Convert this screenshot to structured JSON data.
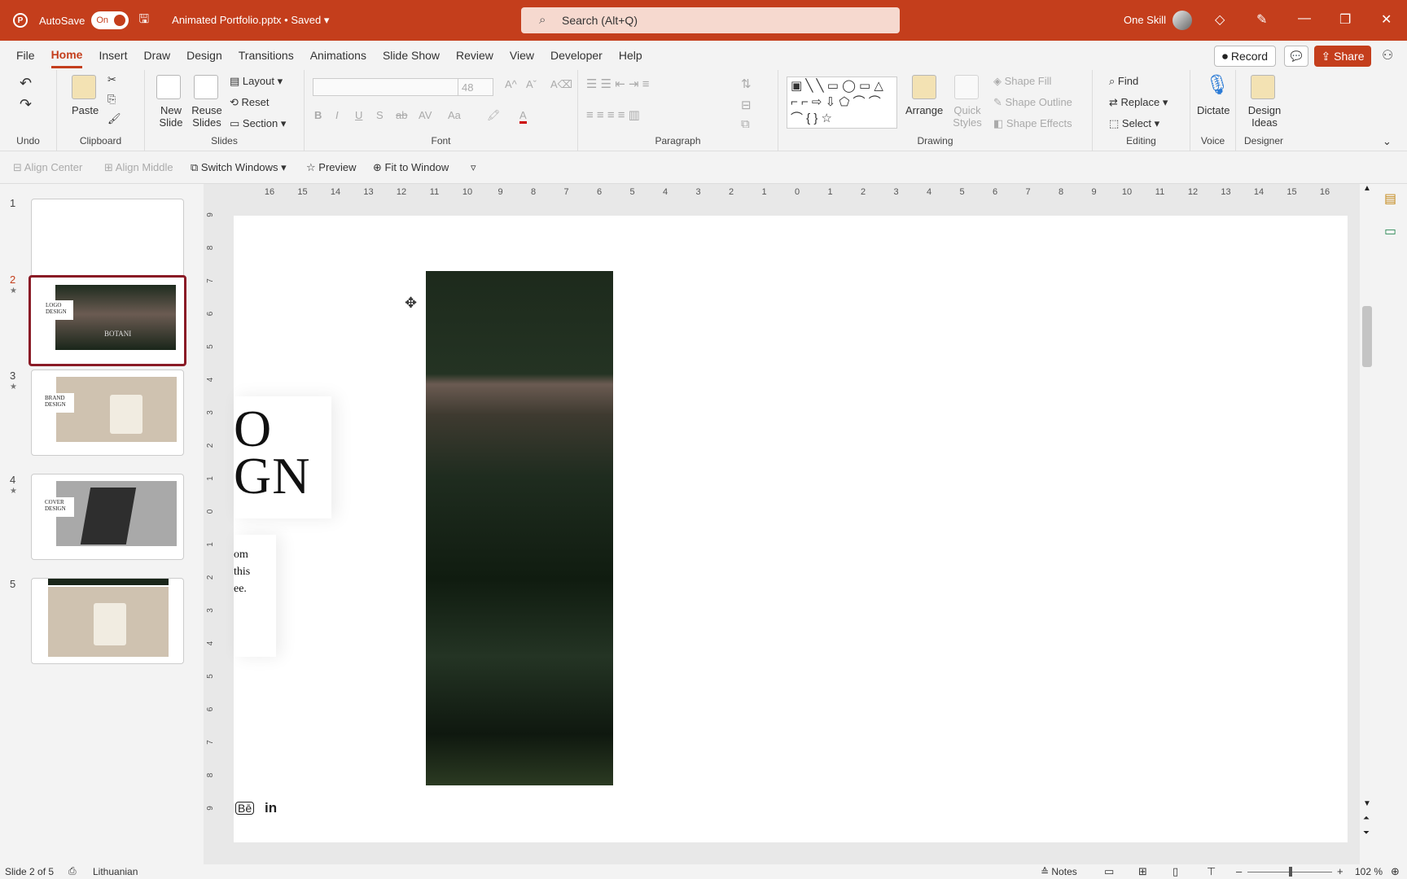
{
  "titlebar": {
    "autosave_label": "AutoSave",
    "autosave_state": "On",
    "file_name": "Animated Portfolio.pptx • Saved",
    "search_placeholder": "Search (Alt+Q)",
    "user_name": "One Skill"
  },
  "menubar": {
    "tabs": [
      "File",
      "Home",
      "Insert",
      "Draw",
      "Design",
      "Transitions",
      "Animations",
      "Slide Show",
      "Review",
      "View",
      "Developer",
      "Help"
    ],
    "active_tab": "Home",
    "record_label": "Record",
    "share_label": "Share"
  },
  "ribbon": {
    "undo": {
      "label": "Undo"
    },
    "clipboard": {
      "label": "Clipboard",
      "paste": "Paste"
    },
    "slides": {
      "label": "Slides",
      "new_slide": "New Slide",
      "reuse_slides": "Reuse Slides",
      "layout": "Layout",
      "reset": "Reset",
      "section": "Section"
    },
    "font": {
      "label": "Font",
      "size": "48"
    },
    "paragraph": {
      "label": "Paragraph"
    },
    "drawing": {
      "label": "Drawing",
      "arrange": "Arrange",
      "quick_styles": "Quick Styles",
      "shape_fill": "Shape Fill",
      "shape_outline": "Shape Outline",
      "shape_effects": "Shape Effects"
    },
    "editing": {
      "label": "Editing",
      "find": "Find",
      "replace": "Replace",
      "select": "Select"
    },
    "voice": {
      "label": "Voice",
      "dictate": "Dictate"
    },
    "designer": {
      "label": "Designer",
      "design_ideas": "Design Ideas"
    }
  },
  "qat": {
    "align_center": "Align Center",
    "align_middle": "Align Middle",
    "switch_windows": "Switch Windows",
    "preview": "Preview",
    "fit_to_window": "Fit to Window"
  },
  "thumbnails": [
    {
      "num": "1",
      "star": false,
      "title": ""
    },
    {
      "num": "2",
      "star": true,
      "title": "LOGO DESIGN",
      "brand": "BOTANI"
    },
    {
      "num": "3",
      "star": true,
      "title": "BRAND DESIGN"
    },
    {
      "num": "4",
      "star": true,
      "title": "COVER DESIGN"
    },
    {
      "num": "5",
      "star": false,
      "title": ""
    }
  ],
  "rulers": {
    "h_ticks": [
      "16",
      "15",
      "14",
      "13",
      "12",
      "11",
      "10",
      "9",
      "8",
      "7",
      "6",
      "5",
      "4",
      "3",
      "2",
      "1",
      "0",
      "1",
      "2",
      "3",
      "4",
      "5",
      "6",
      "7",
      "8",
      "9",
      "10",
      "11",
      "12",
      "13",
      "14",
      "15",
      "16"
    ],
    "v_ticks": [
      "9",
      "8",
      "7",
      "6",
      "5",
      "4",
      "3",
      "2",
      "1",
      "0",
      "1",
      "2",
      "3",
      "4",
      "5",
      "6",
      "7",
      "8",
      "9"
    ]
  },
  "slide": {
    "heading_line1": "O",
    "heading_line2": "GN",
    "body_line1": "om",
    "body_line2": "this",
    "body_line3": "ee."
  },
  "statusbar": {
    "slide_info": "Slide 2 of 5",
    "language": "Lithuanian",
    "notes": "Notes",
    "zoom": "102 %"
  }
}
